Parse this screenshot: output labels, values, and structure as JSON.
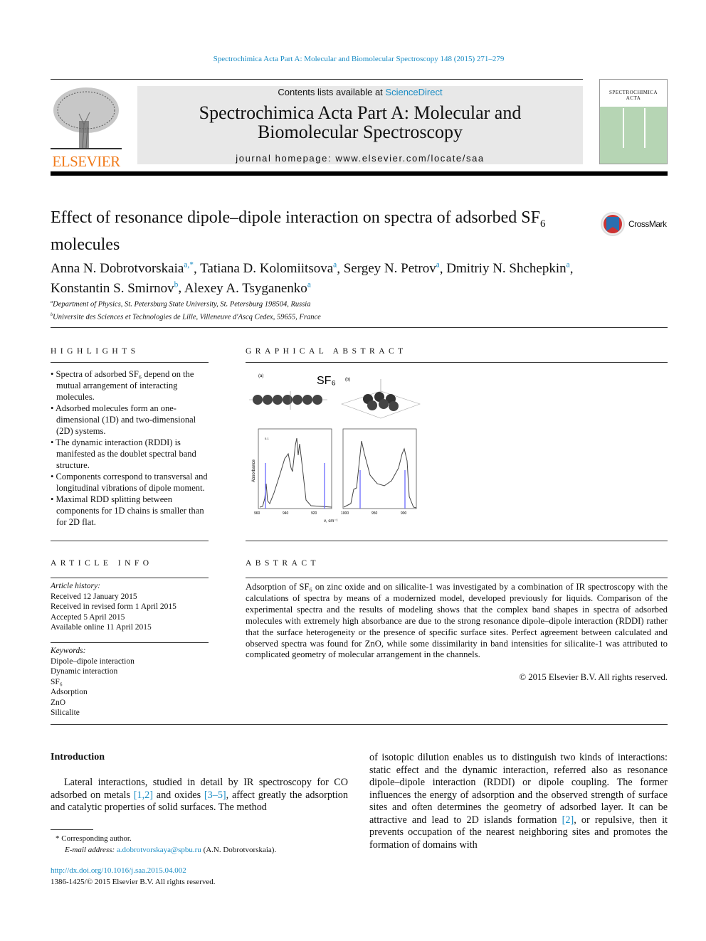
{
  "journal_citation": "Spectrochimica Acta Part A: Molecular and Biomolecular Spectroscopy 148 (2015) 271–279",
  "header": {
    "contents_prefix": "Contents lists available at ",
    "sciencedirect": "ScienceDirect",
    "journal_title_line1": "Spectrochimica Acta Part A: Molecular and",
    "journal_title_line2": "Biomolecular Spectroscopy",
    "homepage": "journal homepage: www.elsevier.com/locate/saa",
    "publisher": "ELSEVIER",
    "cover_title_1": "SPECTROCHIMICA",
    "cover_title_2": "ACTA"
  },
  "article": {
    "title_main": "Effect of resonance dipole–dipole interaction on spectra of adsorbed SF",
    "title_sub": "6",
    "title_end": "molecules",
    "crossmark": "CrossMark",
    "authors": [
      {
        "name": "Anna N. Dobrotvorskaia",
        "sup": "a,*"
      },
      {
        "name": "Tatiana D. Kolomiitsova",
        "sup": "a"
      },
      {
        "name": "Sergey N. Petrov",
        "sup": "a"
      },
      {
        "name": "Dmitriy N. Shchepkin",
        "sup": "a"
      },
      {
        "name": "Konstantin S. Smirnov",
        "sup": "b"
      },
      {
        "name": "Alexey A. Tsyganenko",
        "sup": "a"
      }
    ],
    "affiliations": [
      {
        "sup": "a",
        "text": "Department of Physics, St. Petersburg State University, St. Petersburg 198504, Russia"
      },
      {
        "sup": "b",
        "text": "Universite des Sciences et Technologies de Lille, Villeneuve d'Ascq Cedex, 59655, France"
      }
    ]
  },
  "highlights": {
    "heading": "HIGHLIGHTS",
    "items": [
      "Spectra of adsorbed SF₆ depend on the mutual arrangement of interacting molecules.",
      "Adsorbed molecules form an one-dimensional (1D) and two-dimensional (2D) systems.",
      "The dynamic interaction (RDDI) is manifested as the doublet spectral band structure.",
      "Components correspond to transversal and longitudinal vibrations of dipole moment.",
      "Maximal RDD splitting between components for 1D chains is smaller than for 2D flat."
    ]
  },
  "graphical_abstract": {
    "heading": "GRAPHICAL ABSTRACT",
    "label_a": "(a)",
    "label_b": "(b)",
    "molecule": "SF₆",
    "y_label": "Absorbance",
    "x_label": "ν, cm⁻¹",
    "scale": "0.1",
    "ticks_left": [
      "960",
      "940",
      "920"
    ],
    "ticks_right": [
      "1000",
      "950",
      "900"
    ]
  },
  "article_info": {
    "heading": "ARTICLE INFO",
    "history_label": "Article history:",
    "history": [
      "Received 12 January 2015",
      "Received in revised form 1 April 2015",
      "Accepted 5 April 2015",
      "Available online 11 April 2015"
    ],
    "keywords_label": "Keywords:",
    "keywords": [
      "Dipole–dipole interaction",
      "Dynamic interaction",
      "SF₆",
      "Adsorption",
      "ZnO",
      "Silicalite"
    ]
  },
  "abstract": {
    "heading": "ABSTRACT",
    "text": "Adsorption of SF₆ on zinc oxide and on silicalite-1 was investigated by a combination of IR spectroscopy with the calculations of spectra by means of a modernized model, developed previously for liquids. Comparison of the experimental spectra and the results of modeling shows that the complex band shapes in spectra of adsorbed molecules with extremely high absorbance are due to the strong resonance dipole–dipole interaction (RDDI) rather that the surface heterogeneity or the presence of specific surface sites. Perfect agreement between calculated and observed spectra was found for ZnO, while some dissimilarity in band intensities for silicalite-1 was attributed to complicated geometry of molecular arrangement in the channels.",
    "copyright": "© 2015 Elsevier B.V. All rights reserved."
  },
  "intro": {
    "heading": "Introduction",
    "p1_a": "Lateral interactions, studied in detail by IR spectroscopy for CO adsorbed on metals ",
    "ref1": "[1,2]",
    "p1_b": " and oxides ",
    "ref2": "[3–5]",
    "p1_c": ", affect greatly the adsorption and catalytic properties of solid surfaces. The method",
    "p2_a": "of isotopic dilution enables us to distinguish two kinds of interactions: static effect and the dynamic interaction, referred also as resonance dipole–dipole interaction (RDDI) or dipole coupling. The former influences the energy of adsorption and the observed strength of surface sites and often determines the geometry of adsorbed layer. It can be attractive and lead to 2D islands formation ",
    "ref3": "[2]",
    "p2_b": ", or repulsive, then it prevents occupation of the nearest neighboring sites and promotes the formation of domains with"
  },
  "footnote": {
    "star": "*",
    "corresponding": "Corresponding author.",
    "email_label": "E-mail address:",
    "email": "a.dobrotvorskaya@spbu.ru",
    "email_name": "(A.N. Dobrotvorskaia)."
  },
  "doi": "http://dx.doi.org/10.1016/j.saa.2015.04.002",
  "issn": "1386-1425/© 2015 Elsevier B.V. All rights reserved."
}
